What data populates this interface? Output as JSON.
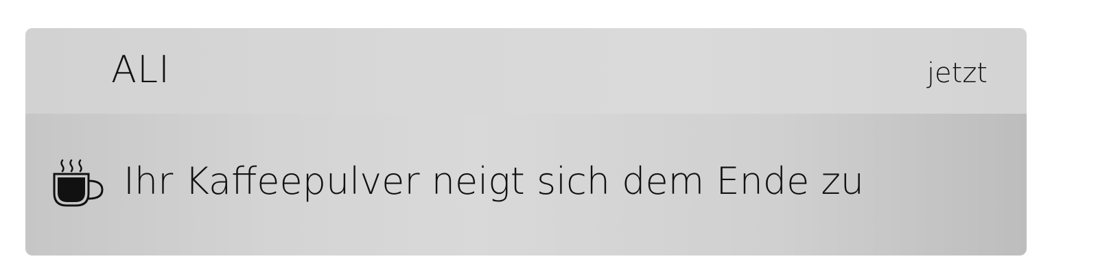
{
  "notification": {
    "app_name": "ALI",
    "timestamp": "jetzt",
    "icon": "coffee-cup-icon",
    "message": "Ihr Kaffeepulver neigt sich dem Ende zu"
  },
  "colors": {
    "header_background": "#d8d8d8",
    "body_background": "#cfcfcf",
    "text": "#111111"
  }
}
